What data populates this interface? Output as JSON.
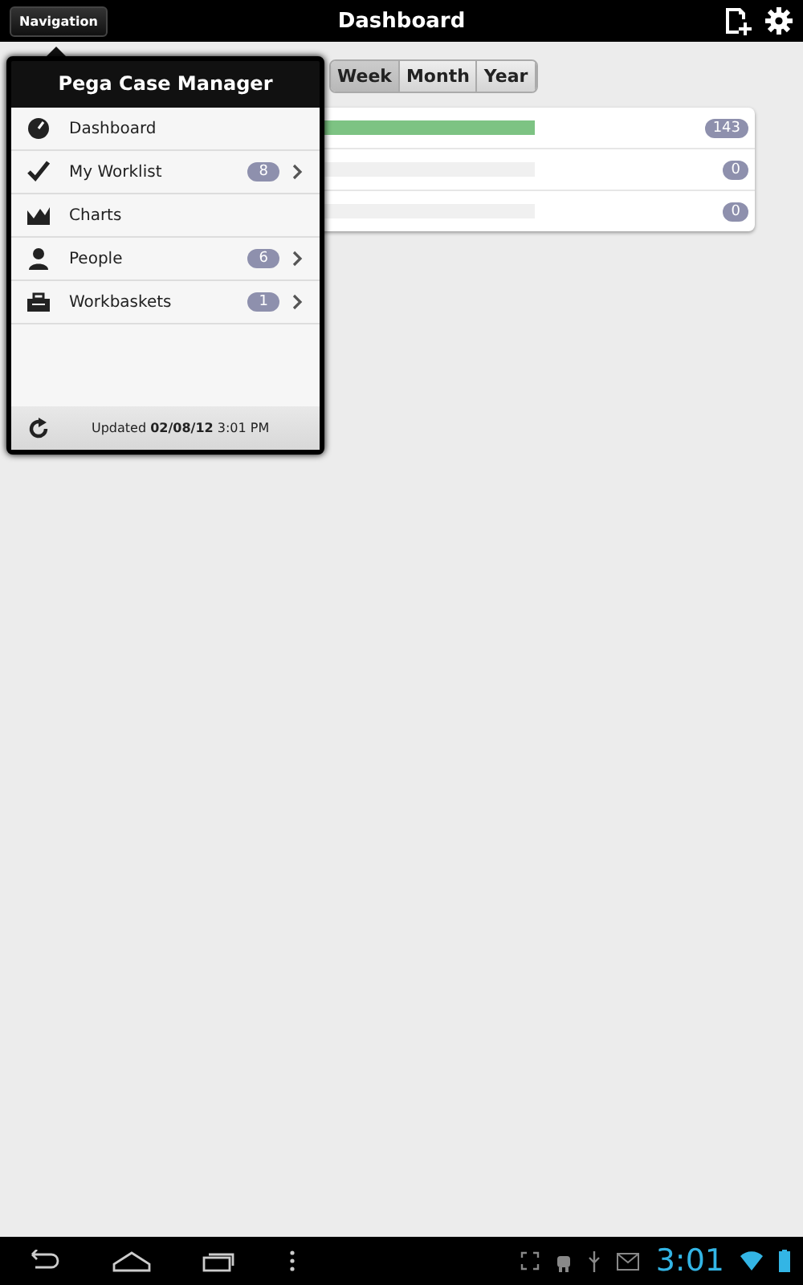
{
  "top_bar": {
    "nav_button": "Navigation",
    "title": "Dashboard"
  },
  "period_tabs": [
    {
      "label": "Week",
      "selected": true
    },
    {
      "label": "Month",
      "selected": false
    },
    {
      "label": "Year",
      "selected": false
    }
  ],
  "chart_rows": [
    {
      "level": 1,
      "count": "143"
    },
    {
      "level": 0,
      "count": "0"
    },
    {
      "level": 0,
      "count": "0"
    }
  ],
  "navigation": {
    "title": "Pega Case Manager",
    "items": [
      {
        "label": "Dashboard",
        "expandable": false
      },
      {
        "label": "My Worklist",
        "count": "8",
        "expandable": true
      },
      {
        "label": "Charts",
        "expandable": false
      },
      {
        "label": "People",
        "count": "6",
        "expandable": true
      },
      {
        "label": "Workbaskets",
        "count": "1",
        "expandable": true
      }
    ],
    "updated": "Updated **02/08/12** 3:01 PM"
  },
  "system_bar": {
    "time": "3:01"
  }
}
